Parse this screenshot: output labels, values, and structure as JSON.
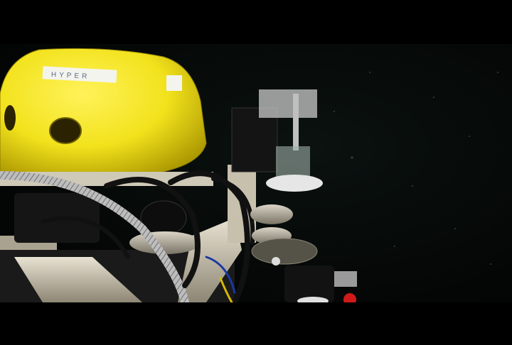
{
  "scene": {
    "hull_label": "HYPER",
    "colors": {
      "water": "#050807",
      "hull_yellow": "#f2e21c",
      "frame_metal": "#cfc9b8",
      "hose_black": "#111111"
    }
  }
}
